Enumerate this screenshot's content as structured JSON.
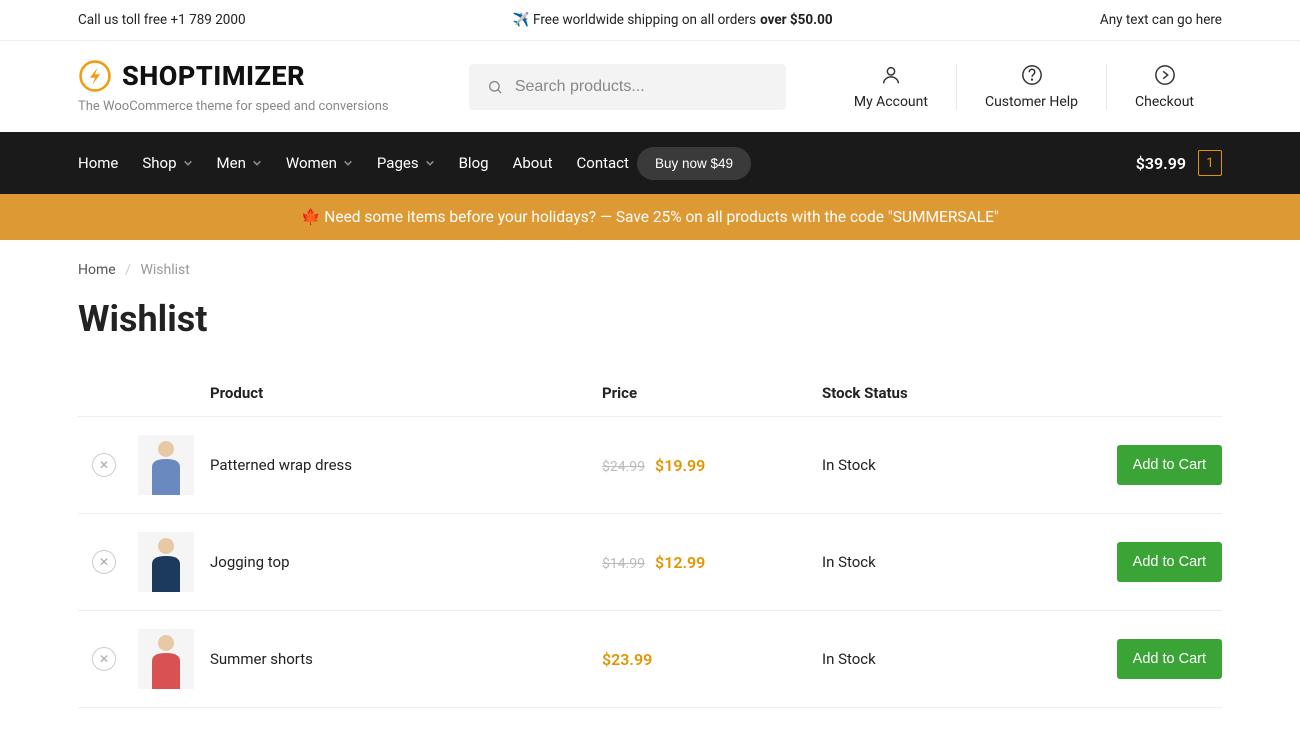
{
  "topbar": {
    "left": "Call us toll free +1 789 2000",
    "center_prefix": "✈️ Free worldwide shipping on all orders ",
    "center_bold": "over $50.00",
    "right": "Any text can go here"
  },
  "header": {
    "logo_text": "SHOPTIMIZER",
    "tagline": "The WooCommerce theme for speed and conversions",
    "search_placeholder": "Search products...",
    "actions": [
      {
        "label": "My Account"
      },
      {
        "label": "Customer Help"
      },
      {
        "label": "Checkout"
      }
    ]
  },
  "nav": {
    "items": [
      {
        "label": "Home",
        "dropdown": false
      },
      {
        "label": "Shop",
        "dropdown": true
      },
      {
        "label": "Men",
        "dropdown": true
      },
      {
        "label": "Women",
        "dropdown": true
      },
      {
        "label": "Pages",
        "dropdown": true
      },
      {
        "label": "Blog",
        "dropdown": false
      },
      {
        "label": "About",
        "dropdown": false
      },
      {
        "label": "Contact",
        "dropdown": false
      }
    ],
    "buy_label": "Buy now $49",
    "cart_total": "$39.99",
    "cart_count": "1"
  },
  "promo": {
    "text": "🍁 Need some items before your holidays? — Save 25% on all products with the code \"SUMMERSALE\""
  },
  "breadcrumb": {
    "home": "Home",
    "current": "Wishlist"
  },
  "page_title": "Wishlist",
  "table": {
    "headers": {
      "product": "Product",
      "price": "Price",
      "stock": "Stock Status"
    },
    "add_to_cart_label": "Add to Cart",
    "rows": [
      {
        "name": "Patterned wrap dress",
        "old_price": "$24.99",
        "price": "$19.99",
        "stock": "In Stock",
        "thumb_color": "#6a8abf",
        "thumb_accent": "#e8c9a6"
      },
      {
        "name": "Jogging top",
        "old_price": "$14.99",
        "price": "$12.99",
        "stock": "In Stock",
        "thumb_color": "#1b3a5e",
        "thumb_accent": "#e8c9a6"
      },
      {
        "name": "Summer shorts",
        "old_price": "",
        "price": "$23.99",
        "stock": "In Stock",
        "thumb_color": "#d95252",
        "thumb_accent": "#e8c9a6"
      }
    ]
  }
}
